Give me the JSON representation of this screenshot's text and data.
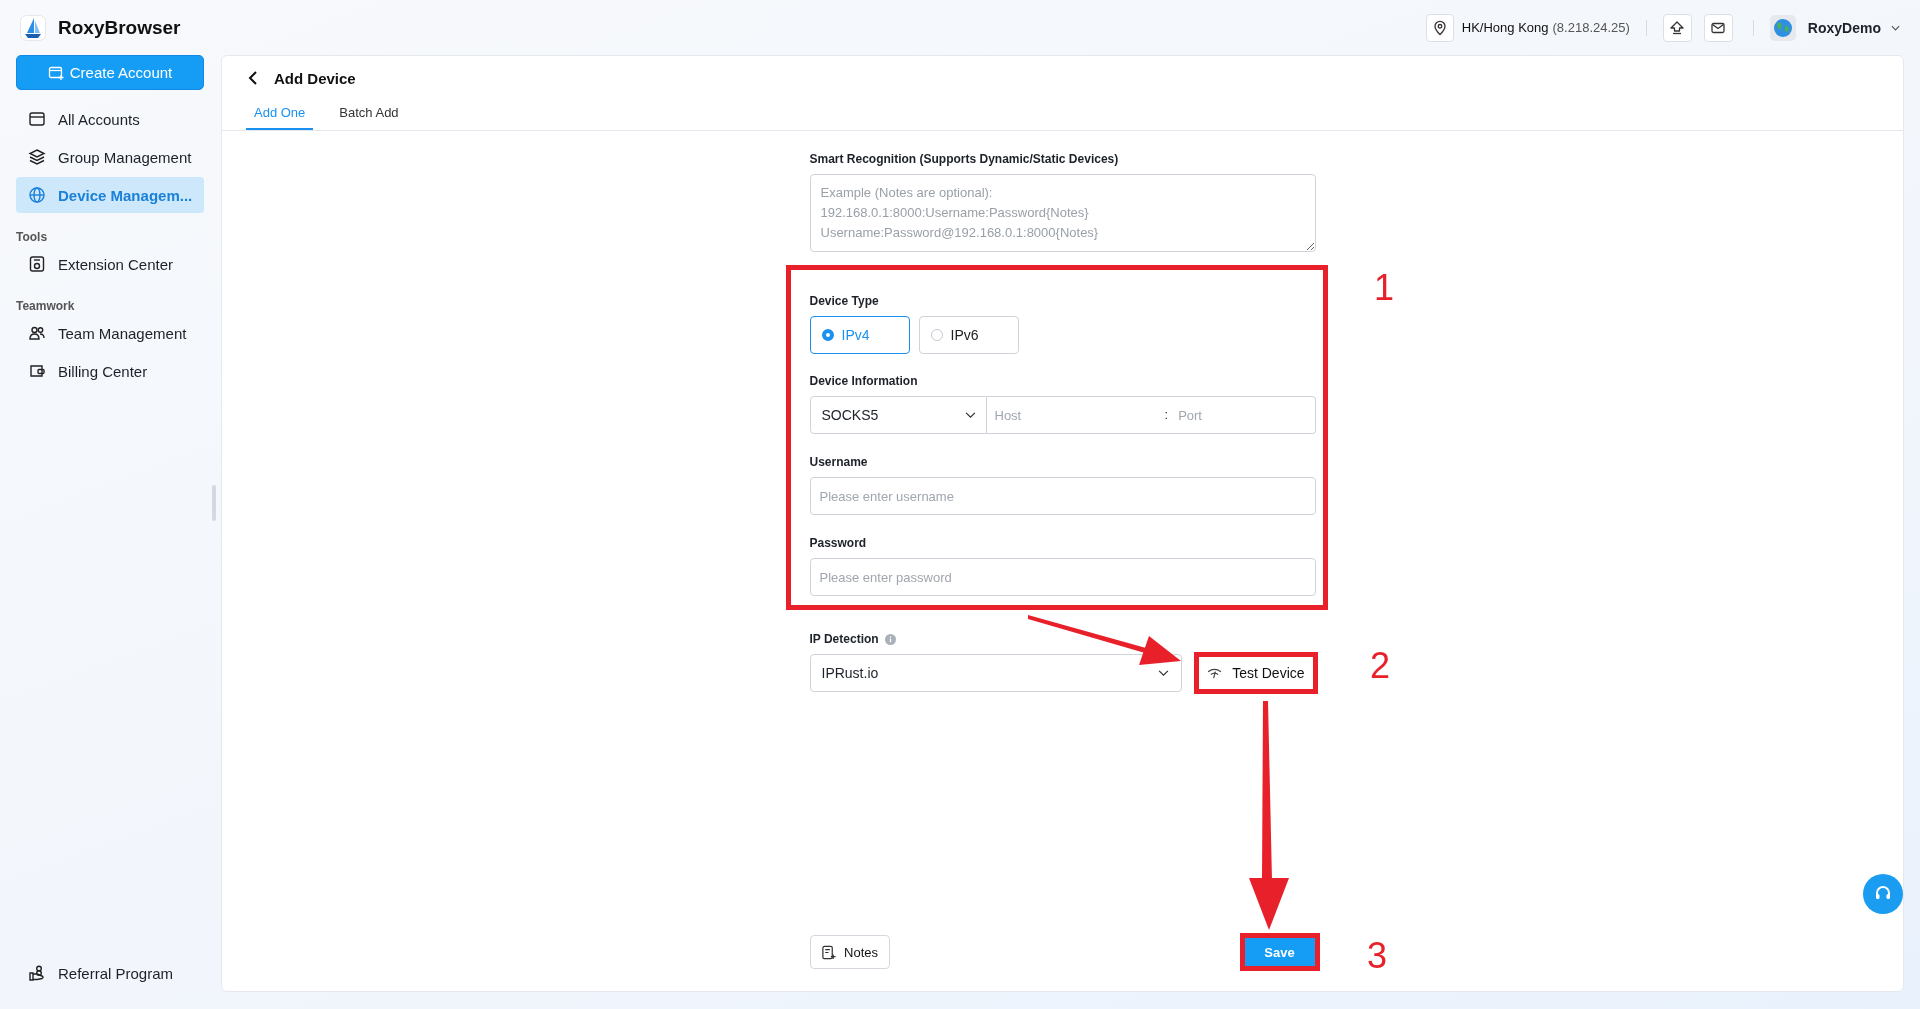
{
  "app": {
    "name": "RoxyBrowser"
  },
  "header": {
    "location": "HK/Hong Kong",
    "ip": "(8.218.24.25)",
    "user": "RoxyDemo"
  },
  "sidebar": {
    "create_button": "Create Account",
    "sections": [
      {
        "items": [
          {
            "label": "All Accounts",
            "selected": false
          },
          {
            "label": "Group Management",
            "selected": false
          },
          {
            "label": "Device Managem...",
            "selected": true
          }
        ]
      },
      {
        "title": "Tools",
        "items": [
          {
            "label": "Extension Center",
            "selected": false
          }
        ]
      },
      {
        "title": "Teamwork",
        "items": [
          {
            "label": "Team Management",
            "selected": false
          },
          {
            "label": "Billing Center",
            "selected": false
          }
        ]
      }
    ],
    "footer_item": {
      "label": "Referral Program"
    }
  },
  "page": {
    "title": "Add Device",
    "tabs": [
      {
        "label": "Add One",
        "selected": true
      },
      {
        "label": "Batch Add",
        "selected": false
      }
    ]
  },
  "form": {
    "smart_recognition": {
      "label": "Smart Recognition (Supports Dynamic/Static Devices)",
      "placeholder": "Example (Notes are optional):\n192.168.0.1:8000:Username:Password{Notes}\nUsername:Password@192.168.0.1:8000{Notes}"
    },
    "device_type": {
      "label": "Device Type",
      "options": [
        {
          "label": "IPv4",
          "selected": true
        },
        {
          "label": "IPv6",
          "selected": false
        }
      ]
    },
    "device_information": {
      "label": "Device Information",
      "protocol": "SOCKS5",
      "host_placeholder": "Host",
      "separator": ":",
      "port_placeholder": "Port"
    },
    "username": {
      "label": "Username",
      "placeholder": "Please enter username"
    },
    "password": {
      "label": "Password",
      "placeholder": "Please enter password"
    },
    "ip_detection": {
      "label": "IP Detection",
      "value": "IPRust.io"
    },
    "test_button": "Test Device",
    "notes_button": "Notes",
    "save_button": "Save"
  },
  "annotations": [
    {
      "label": "1"
    },
    {
      "label": "2"
    },
    {
      "label": "3"
    }
  ]
}
